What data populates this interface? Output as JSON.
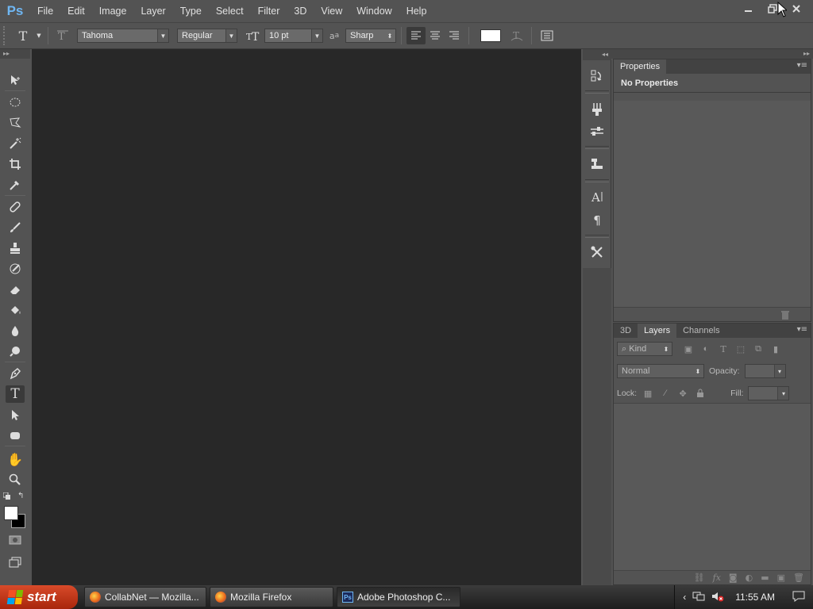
{
  "app": {
    "logo": "Ps"
  },
  "menu": [
    "File",
    "Edit",
    "Image",
    "Layer",
    "Type",
    "Select",
    "Filter",
    "3D",
    "View",
    "Window",
    "Help"
  ],
  "window_controls": {
    "minimize": "minimize-icon",
    "restore": "restore-icon",
    "close": "close-icon"
  },
  "options_bar": {
    "font_family": "Tahoma",
    "font_style": "Regular",
    "font_size": "10 pt",
    "antialias_icon_label": "a",
    "antialias": "Sharp",
    "text_color": "#ffffff"
  },
  "tools": [
    {
      "name": "move-tool",
      "icon": "move-icon"
    },
    {
      "name": "marquee-tool",
      "icon": "ellipse-marquee-icon"
    },
    {
      "name": "lasso-tool",
      "icon": "polygonal-lasso-icon"
    },
    {
      "name": "magic-wand-tool",
      "icon": "magic-wand-icon"
    },
    {
      "name": "crop-tool",
      "icon": "crop-icon"
    },
    {
      "name": "eyedropper-tool",
      "icon": "eyedropper-icon"
    },
    {
      "name": "healing-tool",
      "icon": "bandage-icon"
    },
    {
      "name": "brush-tool",
      "icon": "brush-icon"
    },
    {
      "name": "stamp-tool",
      "icon": "stamp-icon"
    },
    {
      "name": "history-brush-tool",
      "icon": "history-brush-icon"
    },
    {
      "name": "eraser-tool",
      "icon": "eraser-icon"
    },
    {
      "name": "paint-bucket-tool",
      "icon": "paint-bucket-icon"
    },
    {
      "name": "blur-tool",
      "icon": "drop-icon"
    },
    {
      "name": "dodge-tool",
      "icon": "dodge-icon"
    },
    {
      "name": "pen-tool",
      "icon": "pen-icon"
    },
    {
      "name": "type-tool",
      "icon": "type-icon",
      "active": true
    },
    {
      "name": "path-select-tool",
      "icon": "arrow-icon"
    },
    {
      "name": "shape-tool",
      "icon": "rounded-rect-icon"
    },
    {
      "name": "hand-tool",
      "icon": "hand-icon"
    },
    {
      "name": "zoom-tool",
      "icon": "zoom-icon"
    }
  ],
  "colors": {
    "foreground": "#ffffff",
    "background": "#000000"
  },
  "properties_panel": {
    "tab": "Properties",
    "title": "No Properties"
  },
  "layers_panel": {
    "tabs": [
      "3D",
      "Layers",
      "Channels"
    ],
    "active_tab": "Layers",
    "filter_kind": "Kind",
    "blend_mode": "Normal",
    "opacity_label": "Opacity:",
    "lock_label": "Lock:",
    "fill_label": "Fill:"
  },
  "taskbar": {
    "start_label": "start",
    "tasks": [
      {
        "label": "CollabNet — Mozilla...",
        "icon": "firefox-icon"
      },
      {
        "label": "Mozilla Firefox",
        "icon": "firefox-icon"
      },
      {
        "label": "Adobe Photoshop C...",
        "icon": "photoshop-icon",
        "active": true
      }
    ],
    "clock": "11:55 AM"
  }
}
